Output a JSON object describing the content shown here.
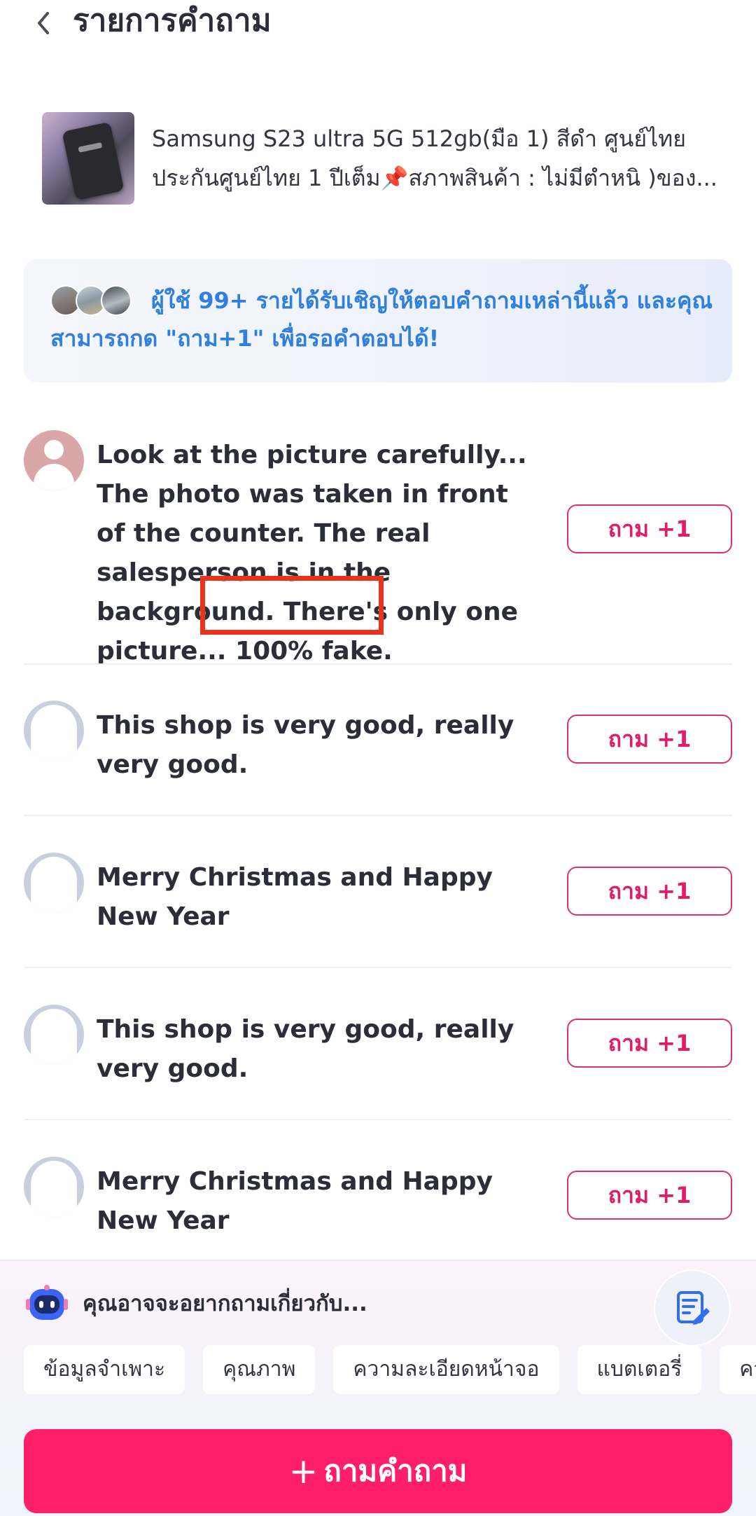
{
  "header": {
    "back_icon": "chevron-left-icon",
    "title": "รายการคำถาม"
  },
  "product": {
    "title_line1": "Samsung S23 ultra 5G 512gb(มือ 1) สีดำ ศูนย์ไทย",
    "title_line2": "ประกันศูนย์ไทย 1 ปีเต็ม📌สภาพสินค้า : ไม่มีตำหนิ  )ของ..."
  },
  "banner": {
    "text": "ผู้ใช้ 99+ รายได้รับเชิญให้ตอบคำถามเหล่านี้แล้ว และคุณสามารถกด \"ถาม+1\" เพื่อรอคำตอบได้!",
    "color": "#2f7fe0"
  },
  "questions": [
    {
      "text": "Look at the picture carefully... The photo was taken in front of the counter. The real salesperson is in the background. There's only one picture... 100% fake.",
      "button": "ถาม +1"
    },
    {
      "text": "This shop is very good, really very good.",
      "button": "ถาม +1"
    },
    {
      "text": "Merry Christmas and Happy New Year",
      "button": "ถาม +1"
    },
    {
      "text": "This shop is very good, really very good.",
      "button": "ถาม +1"
    },
    {
      "text": "Merry Christmas and Happy New Year",
      "button": "ถาม +1"
    }
  ],
  "suggestions": {
    "title": "คุณอาจจะอยากถามเกี่ยวกับ...",
    "chips": [
      "ข้อมูลจำเพาะ",
      "คุณภาพ",
      "ความละเอียดหน้าจอ",
      "แบตเตอรี่",
      "คว"
    ]
  },
  "footer": {
    "ask_label": "ถามคำถาม",
    "accent_color": "#fe1e6a"
  }
}
